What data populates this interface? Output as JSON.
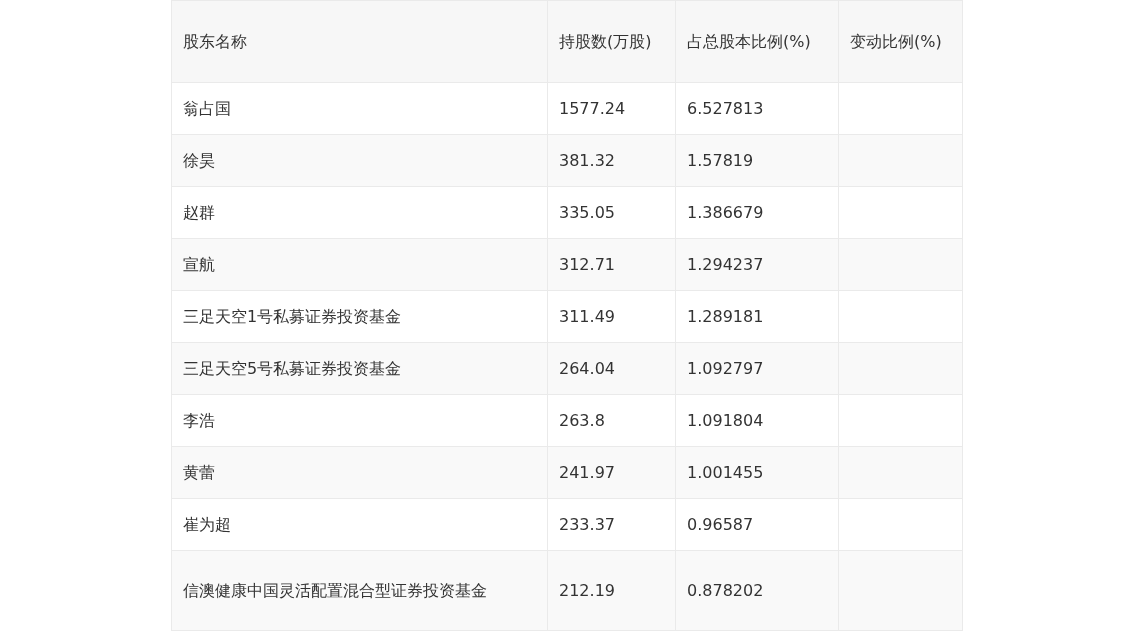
{
  "table": {
    "columns": [
      "股东名称",
      "持股数(万股)",
      "占总股本比例(%)",
      "变动比例(%)"
    ],
    "rows": [
      {
        "name": "翁占国",
        "shares": "1577.24",
        "ratio": "6.527813"
      },
      {
        "name": "徐昊",
        "shares": "381.32",
        "ratio": "1.57819"
      },
      {
        "name": "赵群",
        "shares": "335.05",
        "ratio": "1.386679"
      },
      {
        "name": "宣航",
        "shares": "312.71",
        "ratio": "1.294237"
      },
      {
        "name": "三足天空1号私募证券投资基金",
        "shares": "311.49",
        "ratio": "1.289181"
      },
      {
        "name": "三足天空5号私募证券投资基金",
        "shares": "264.04",
        "ratio": "1.092797"
      },
      {
        "name": "李浩",
        "shares": "263.8",
        "ratio": "1.091804"
      },
      {
        "name": "黄蕾",
        "shares": "241.97",
        "ratio": "1.001455"
      },
      {
        "name": "崔为超",
        "shares": "233.37",
        "ratio": "0.96587"
      },
      {
        "name": "信澳健康中国灵活配置混合型证券投资基金",
        "shares": "212.19",
        "ratio": "0.878202"
      }
    ]
  }
}
